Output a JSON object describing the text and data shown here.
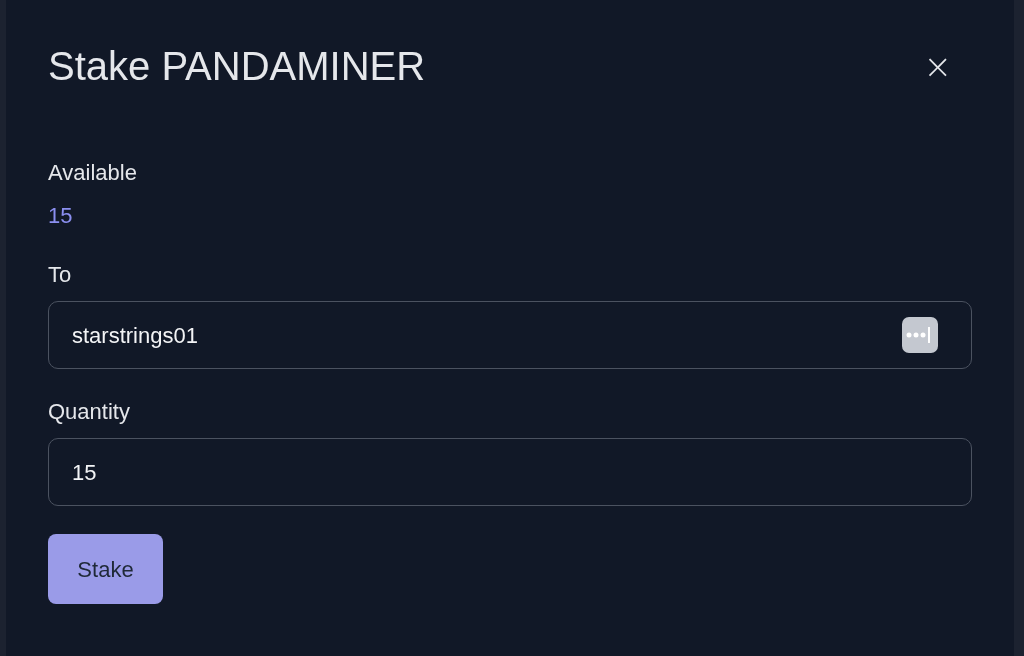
{
  "dialog": {
    "title": "Stake PANDAMINER",
    "close": "×"
  },
  "available": {
    "label": "Available",
    "value": "15"
  },
  "fields": [
    {
      "label": "To",
      "value": "starstrings01",
      "password_manager": true
    },
    {
      "label": "Quantity",
      "value": "15",
      "password_manager": false
    }
  ],
  "submit": "Stake"
}
